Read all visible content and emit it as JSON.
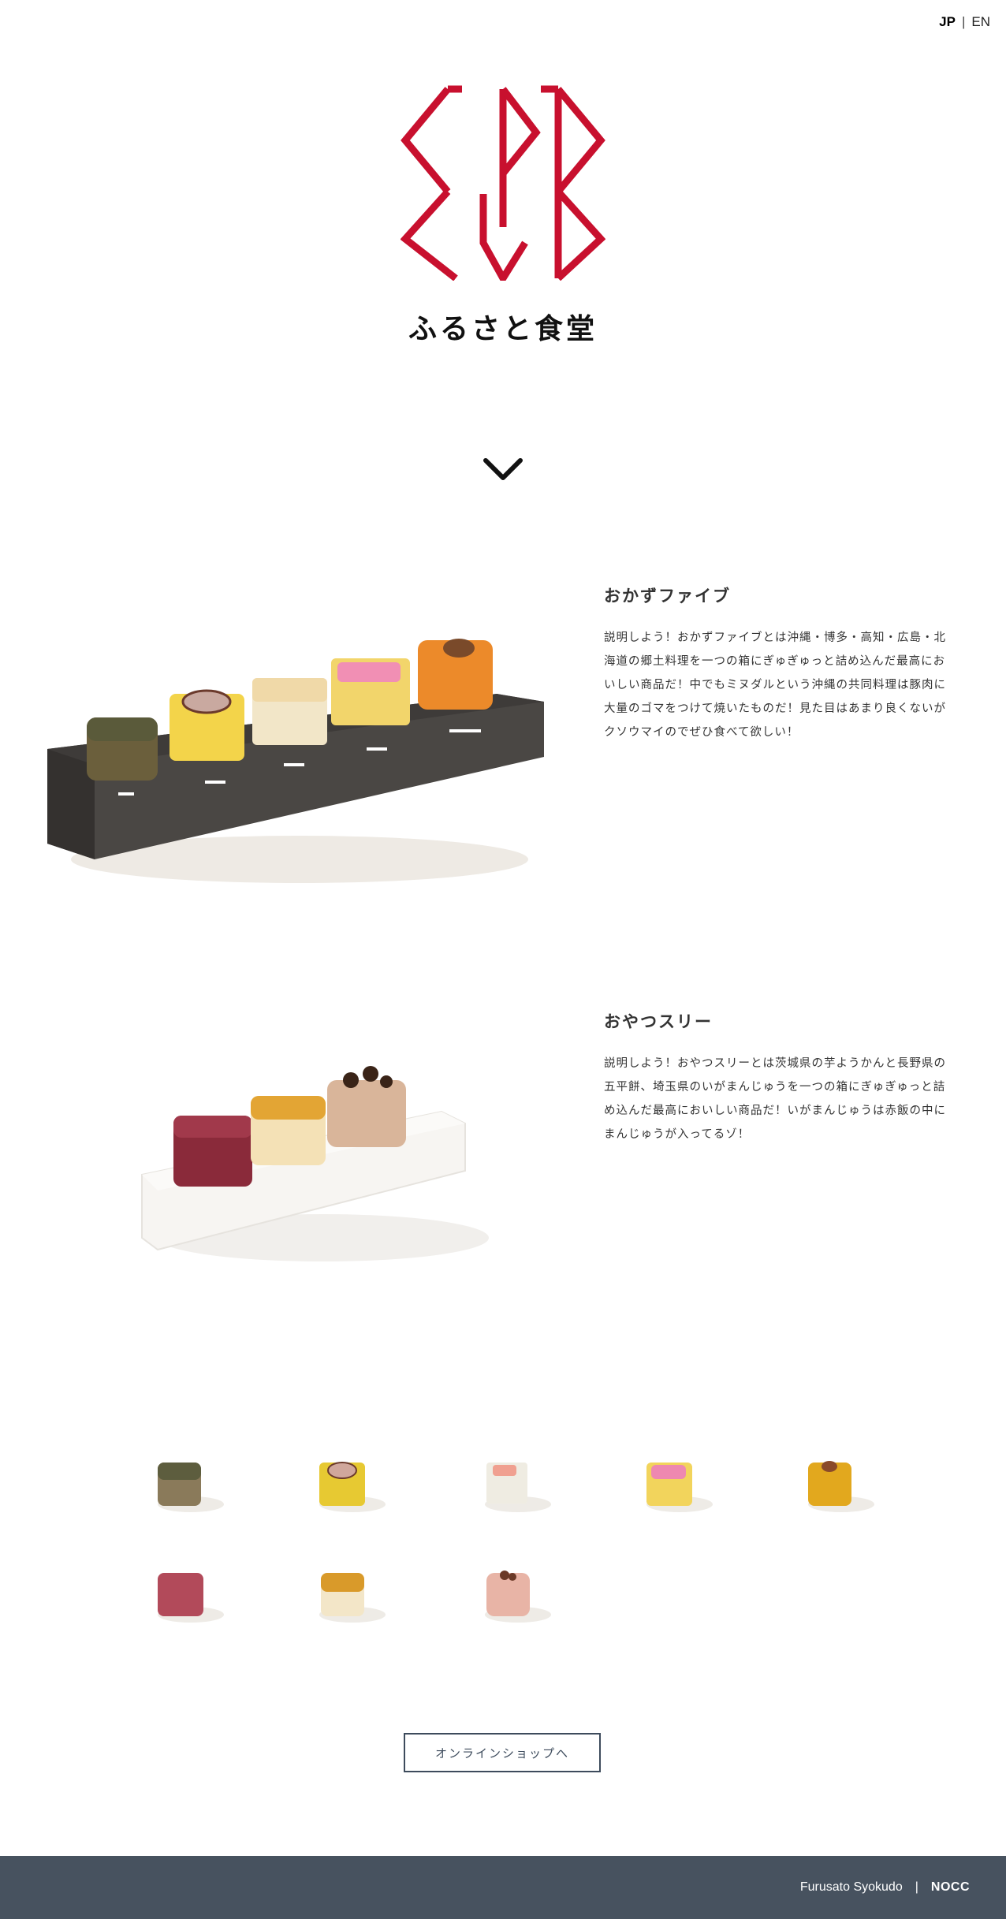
{
  "header": {
    "lang_active": "JP",
    "lang_separator": "|",
    "lang_other": "EN"
  },
  "brand": {
    "title": "ふるさと食堂",
    "logo_color": "#c8102e"
  },
  "products": [
    {
      "title": "おかずファイブ",
      "description": "説明しよう！おかずファイブとは沖縄・博多・高知・広島・北海道の郷土料理を一つの箱にぎゅぎゅっと詰め込んだ最高においしい商品だ！中でもミヌダルという沖縄の共同料理は豚肉に大量のゴマをつけて焼いたものだ！見た目はあまり良くないがクソウマイのでぜひ食べて欲しい！"
    },
    {
      "title": "おやつスリー",
      "description": "説明しよう！おやつスリーとは茨城県の芋ようかんと長野県の五平餅、埼玉県のいがまんじゅうを一つの箱にぎゅぎゅっと詰め込んだ最高においしい商品だ！いがまんじゅうは赤飯の中にまんじゅうが入ってるゾ！"
    }
  ],
  "shop_button": {
    "label": "オンラインショップへ"
  },
  "footer": {
    "site_name": "Furusato Syokudo",
    "separator": "|",
    "company": "NOCC"
  },
  "colors": {
    "accent_red": "#c8102e",
    "footer_bg": "#47525f",
    "button_border": "#3d4b5c"
  }
}
